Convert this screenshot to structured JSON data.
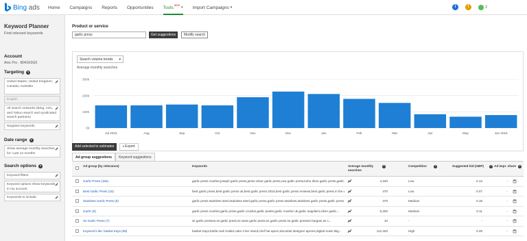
{
  "brand": {
    "name": "Bing",
    "suffix": " ads"
  },
  "nav": {
    "items": [
      {
        "label": "Home"
      },
      {
        "label": "Campaigns"
      },
      {
        "label": "Reports"
      },
      {
        "label": "Opportunities"
      },
      {
        "label": "Tools",
        "badge": "NEW",
        "active": true
      },
      {
        "label": "Import Campaigns"
      }
    ]
  },
  "header_icons": {
    "bulb_count": "2"
  },
  "left": {
    "title": "Keyword Planner",
    "subtitle": "Find relevant keywords",
    "account_label": "Account",
    "account_value": "Amc Pro - B041K0G9",
    "targeting_label": "Targeting",
    "targeting_items": [
      "United States; United Kingdom; Canada; Australia",
      "English",
      "All search networks (Bing, AOL, and Yahoo search and syndicated search partners)",
      "Negative keywords"
    ],
    "date_label": "Date range",
    "date_value": "Show average monthly searches for: Last 12 months",
    "options_label": "Search options",
    "option_items": [
      "Keyword filters",
      "Keyword options Show keywords in my account",
      "Keywords to include"
    ]
  },
  "search": {
    "label": "Product or service",
    "value": "garlic press",
    "get_button": "Get suggestions",
    "modify_button": "Modify search"
  },
  "chart_data": {
    "type": "bar",
    "control_label": "Search volume trends",
    "title": "Average monthly searches",
    "categories": [
      "Jul 2015",
      "Aug",
      "Sep",
      "Oct",
      "Nov",
      "Dec",
      "Jan",
      "Feb",
      "Mar",
      "Apr",
      "May",
      "Jun 2016"
    ],
    "values": [
      140000,
      140000,
      145000,
      140000,
      190000,
      225000,
      210000,
      180000,
      155000,
      85000,
      70000,
      80000
    ],
    "y_ticks": [
      "0k",
      "100k",
      "200k",
      "300k"
    ],
    "ylim": [
      0,
      300000
    ],
    "bar_color": "#1e7fd4",
    "grid": true
  },
  "toolbar": {
    "add_button": "Add selected to estimates",
    "export_button": "Export"
  },
  "tabs": [
    "Ad group suggestions",
    "Keyword suggestions"
  ],
  "table": {
    "headers": {
      "adgroup": "Ad group (by relevance)",
      "keywords": "Keywords",
      "avg": "Average monthly searches",
      "competition": "Competition",
      "bid": "Suggested bid (GBP)",
      "share": "Ad impr. share"
    },
    "rows": [
      {
        "adgroup": "Garlic Press (165)",
        "keywords": "garlic press crusher,joseph garlic press,jamie oliver garlic press,oxo garlic press,kuhn rikon garlic press,garlic press,garlic press rev...",
        "avg": "4,340",
        "competition": "Low",
        "bid": "0.13",
        "share": "-"
      },
      {
        "adgroup": "Best Garlic Press (15)",
        "keywords": "best garlic press,best garlic press uk,best garlic press 2016,best garlic press reviews,best garlic press in the world,best garlic press ...",
        "avg": "470",
        "competition": "Low",
        "bid": "0.07",
        "share": "-"
      },
      {
        "adgroup": "Stainless Garlic Press (5)",
        "keywords": "garlic press stainless steel,stainless steel garlic press,garlic press stainless,stainless garlic press,garlic press steel...",
        "avg": "470",
        "competition": "Medium",
        "bid": "0.18",
        "share": "-"
      },
      {
        "adgroup": "Garlic (8)",
        "keywords": "garlic press crusher,garlic press,garlic crusher,garlic peeler,garlic crusher uk,garlic suppliers,silver garlic...",
        "avg": "5,250",
        "competition": "Medium",
        "bid": "0.11",
        "share": "-"
      },
      {
        "adgroup": "Ss Garlic Press (7)",
        "keywords": "ss garlic presses,ss garlic press,ss www garlic press,ss garlic press.ss garlic presses bargain,ss c...",
        "avg": "10",
        "competition": "-",
        "bid": "-",
        "share": "-"
      },
      {
        "adgroup": "Keyword Like: basket trays (69)",
        "keywords": "basket trays,bottle rack holder,cake 3 tier stand,chef hat apron,decanter,designer aprons,digital scale 5kg...",
        "avg": "112,420",
        "competition": "High",
        "bid": "0.28",
        "share": "-"
      }
    ]
  }
}
